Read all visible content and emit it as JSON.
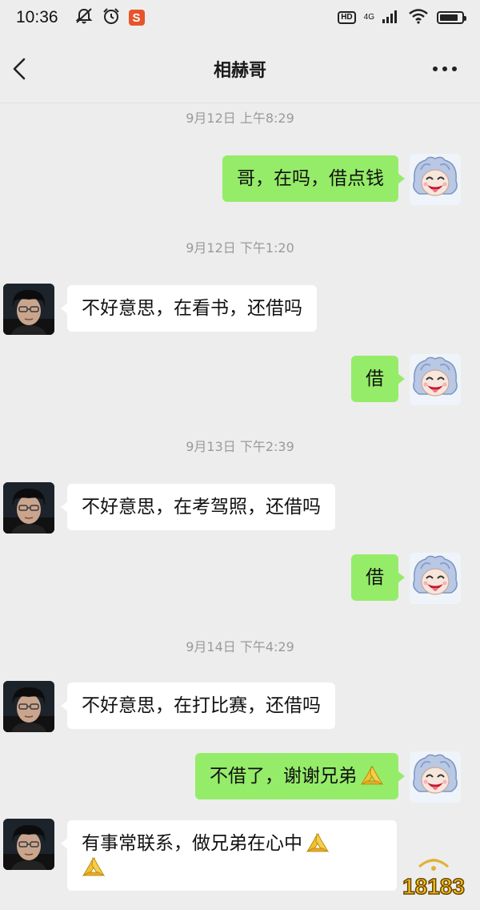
{
  "status": {
    "time": "10:36",
    "hd": "HD",
    "network": "4G"
  },
  "header": {
    "title": "相赫哥"
  },
  "messages": [
    {
      "type": "time",
      "text": "9月12日 上午8:29"
    },
    {
      "type": "out",
      "text": "哥，在吗，借点钱"
    },
    {
      "type": "time",
      "text": "9月12日 下午1:20"
    },
    {
      "type": "in",
      "text": "不好意思，在看书，还借吗"
    },
    {
      "type": "out",
      "text": "借"
    },
    {
      "type": "time",
      "text": "9月13日 下午2:39"
    },
    {
      "type": "in",
      "text": "不好意思，在考驾照，还借吗"
    },
    {
      "type": "out",
      "text": "借"
    },
    {
      "type": "time",
      "text": "9月14日 下午4:29"
    },
    {
      "type": "in",
      "text": "不好意思，在打比赛，还借吗"
    },
    {
      "type": "out",
      "text": "不借了，谢谢兄弟"
    },
    {
      "type": "in",
      "text": "有事常联系，做兄弟在心中"
    }
  ],
  "watermark": {
    "text": "18183"
  },
  "colors": {
    "background": "#ededed",
    "outgoing_bubble": "#95ec69",
    "incoming_bubble": "#ffffff",
    "timestamp": "#9a9a9a"
  },
  "icons": {
    "back": "chevron-left-icon",
    "more": "more-dots-icon",
    "emoji": "folded-hands-emoji"
  }
}
